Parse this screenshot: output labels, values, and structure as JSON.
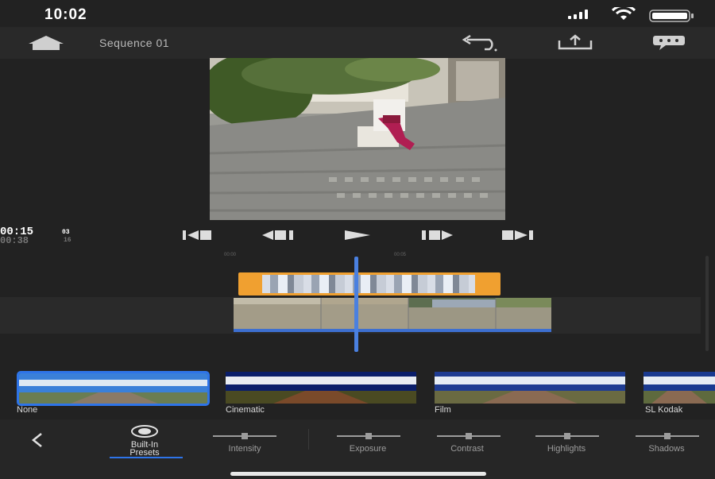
{
  "status_bar": {
    "time": "10:02"
  },
  "header": {
    "title": "Sequence 01"
  },
  "timecode": {
    "current": "00:15",
    "current_frames": "03",
    "total": "00:38",
    "total_frames": "16"
  },
  "ruler": {
    "mark_a": "00:00",
    "mark_b": "00:05"
  },
  "presets": [
    {
      "label": "None"
    },
    {
      "label": "Cinematic"
    },
    {
      "label": "Film"
    },
    {
      "label": "SL Kodak"
    }
  ],
  "tools": [
    {
      "label": "Built-In\nPresets"
    },
    {
      "label": "Intensity"
    },
    {
      "label": "Exposure"
    },
    {
      "label": "Contrast"
    },
    {
      "label": "Highlights"
    },
    {
      "label": "Shadows"
    }
  ],
  "colors": {
    "accent": "#2e74e8",
    "selection_clip": "#f0a030",
    "background": "#222222"
  }
}
